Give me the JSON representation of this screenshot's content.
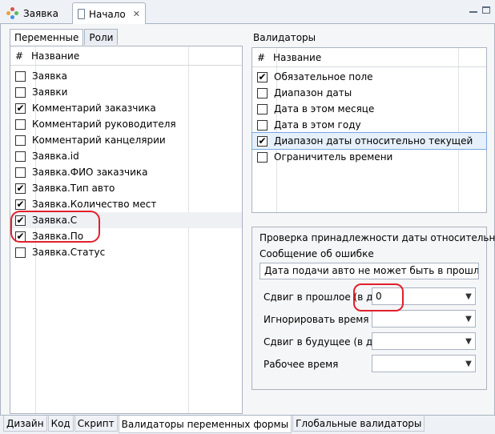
{
  "editor_tabs": [
    {
      "label": "Заявка"
    },
    {
      "label": "Начало"
    }
  ],
  "left_panel": {
    "tabs": [
      "Переменные",
      "Роли"
    ],
    "columns": {
      "hash": "#",
      "name": "Название"
    },
    "rows": [
      {
        "label": "Заявка",
        "checked": false
      },
      {
        "label": "Заявки",
        "checked": false
      },
      {
        "label": "Комментарий заказчика",
        "checked": true
      },
      {
        "label": "Комментарий руководителя",
        "checked": false
      },
      {
        "label": "Комментарий канцелярии",
        "checked": false
      },
      {
        "label": "Заявка.id",
        "checked": false
      },
      {
        "label": "Заявка.ФИО заказчика",
        "checked": false
      },
      {
        "label": "Заявка.Тип авто",
        "checked": true
      },
      {
        "label": "Заявка.Количество мест",
        "checked": true
      },
      {
        "label": "Заявка.С",
        "checked": true
      },
      {
        "label": "Заявка.По",
        "checked": true
      },
      {
        "label": "Заявка.Статус",
        "checked": false
      }
    ]
  },
  "validators": {
    "title": "Валидаторы",
    "columns": {
      "hash": "#",
      "name": "Название"
    },
    "rows": [
      {
        "label": "Обязательное поле",
        "checked": true
      },
      {
        "label": "Диапазон даты",
        "checked": false
      },
      {
        "label": "Дата в этом месяце",
        "checked": false
      },
      {
        "label": "Дата в этом году",
        "checked": false
      },
      {
        "label": "Диапазон даты относительно текущей",
        "checked": true
      },
      {
        "label": "Ограничитель времени",
        "checked": false
      }
    ]
  },
  "form": {
    "heading": "Проверка принадлежности даты относительному",
    "error_label": "Сообщение об ошибке",
    "error_value": "Дата подачи авто не может быть в прошлом",
    "fields": [
      {
        "label": "Сдвиг в прошлое (в дня",
        "value": "0"
      },
      {
        "label": "Игнорировать время",
        "value": ""
      },
      {
        "label": "Сдвиг в будущее (в дня",
        "value": ""
      },
      {
        "label": "Рабочее время",
        "value": ""
      }
    ]
  },
  "bottom_tabs": [
    "Дизайн",
    "Код",
    "Скрипт",
    "Валидаторы переменных формы",
    "Глобальные валидаторы"
  ],
  "colors": {
    "annotation": "#e0202c"
  }
}
